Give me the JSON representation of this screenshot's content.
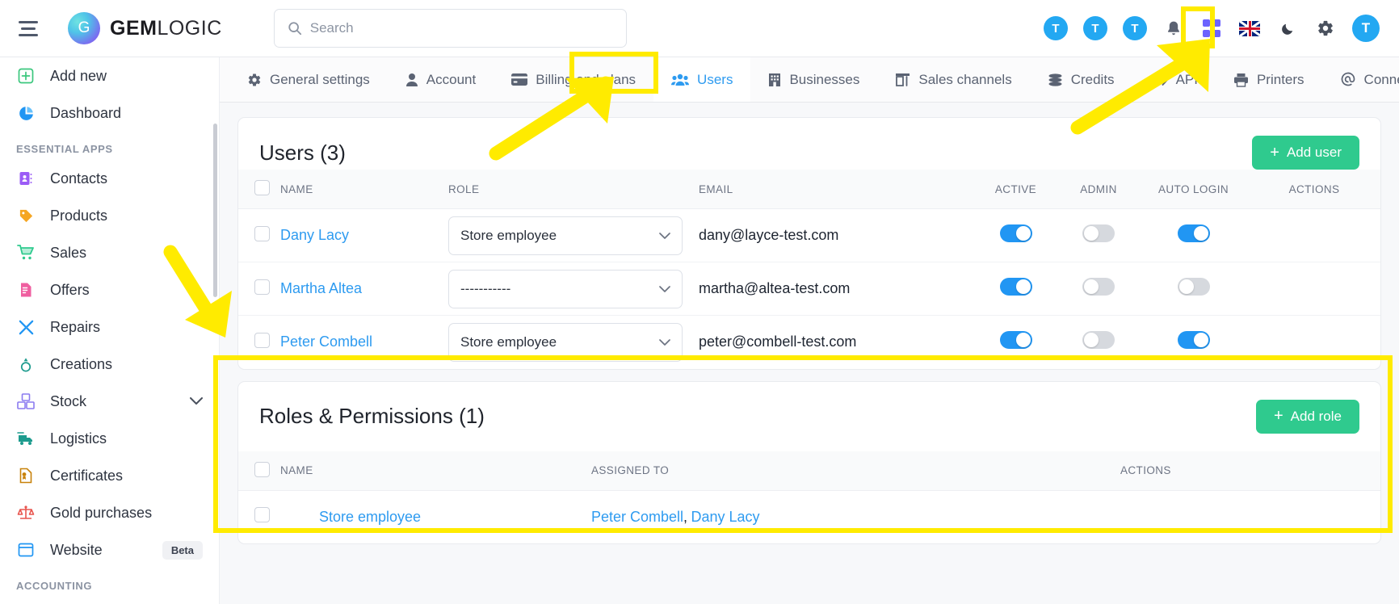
{
  "app": {
    "brand_bold": "GEM",
    "brand_light": "LOGIC",
    "brand_mark_letter": "G"
  },
  "search": {
    "placeholder": "Search",
    "value": ""
  },
  "topbar": {
    "avatars": [
      "T",
      "T",
      "T"
    ],
    "user_avatar": "T",
    "icons": [
      "bell-icon",
      "apps-grid-icon",
      "uk-flag-icon",
      "dark-mode-icon",
      "gear-icon"
    ]
  },
  "sidebar": {
    "items": [
      {
        "label": "Add new",
        "icon": "plus-square-icon",
        "color": "#3bc77d"
      },
      {
        "label": "Dashboard",
        "icon": "pie-chart-icon",
        "color": "#2196f3"
      }
    ],
    "group_label": "ESSENTIAL APPS",
    "apps": [
      {
        "label": "Contacts",
        "icon": "contacts-book-icon",
        "color": "#9b5cf6"
      },
      {
        "label": "Products",
        "icon": "price-tag-icon",
        "color": "#f5a623"
      },
      {
        "label": "Sales",
        "icon": "shopping-cart-icon",
        "color": "#2fca8e"
      },
      {
        "label": "Offers",
        "icon": "offer-document-icon",
        "color": "#ef5fa0"
      },
      {
        "label": "Repairs",
        "icon": "tools-icon",
        "color": "#2196f3"
      },
      {
        "label": "Creations",
        "icon": "ring-icon",
        "color": "#1d9b8e"
      },
      {
        "label": "Stock",
        "icon": "boxes-icon",
        "color": "#8b7bf0",
        "chevron": "⌄"
      },
      {
        "label": "Logistics",
        "icon": "delivery-truck-icon",
        "color": "#1d9b8e"
      },
      {
        "label": "Certificates",
        "icon": "certificate-icon",
        "color": "#c8820a"
      },
      {
        "label": "Gold purchases",
        "icon": "scales-icon",
        "color": "#e8554e"
      },
      {
        "label": "Website",
        "icon": "browser-window-icon",
        "color": "#2196f3",
        "badge": "Beta"
      }
    ],
    "group_label_2": "ACCOUNTING"
  },
  "tabs": [
    {
      "label": "General settings",
      "icon": "gear-icon",
      "active": false
    },
    {
      "label": "Account",
      "icon": "person-icon",
      "active": false
    },
    {
      "label": "Billing and plans",
      "icon": "credit-card-icon",
      "active": false
    },
    {
      "label": "Users",
      "icon": "users-group-icon",
      "active": true
    },
    {
      "label": "Businesses",
      "icon": "building-icon",
      "active": false
    },
    {
      "label": "Sales channels",
      "icon": "storefront-icon",
      "active": false
    },
    {
      "label": "Credits",
      "icon": "coins-icon",
      "active": false
    },
    {
      "label": "API",
      "icon": "code-brackets-icon",
      "active": false
    },
    {
      "label": "Printers",
      "icon": "printer-icon",
      "active": false
    },
    {
      "label": "Connections",
      "icon": "at-link-icon",
      "active": false
    }
  ],
  "users_panel": {
    "title": "Users (3)",
    "add_button": "Add user",
    "add_button_plus": "+",
    "columns": [
      "NAME",
      "ROLE",
      "EMAIL",
      "ACTIVE",
      "ADMIN",
      "AUTO LOGIN",
      "ACTIONS"
    ],
    "rows": [
      {
        "name": "Dany Lacy",
        "role": "Store employee",
        "email": "dany@layce-test.com",
        "active": true,
        "admin": false,
        "auto_login": true
      },
      {
        "name": "Martha Altea",
        "role": "-----------",
        "email": "martha@altea-test.com",
        "active": true,
        "admin": false,
        "auto_login": false
      },
      {
        "name": "Peter Combell",
        "role": "Store employee",
        "email": "peter@combell-test.com",
        "active": true,
        "admin": false,
        "auto_login": true
      }
    ]
  },
  "roles_panel": {
    "title": "Roles & Permissions (1)",
    "add_button": "Add role",
    "add_button_plus": "+",
    "columns": [
      "NAME",
      "ASSIGNED TO",
      "ACTIONS"
    ],
    "rows": [
      {
        "name": "Store employee",
        "assigned_to": [
          "Peter Combell",
          "Dany Lacy"
        ],
        "assigned_separator": ","
      }
    ]
  },
  "annotations": {
    "highlight_color": "#ffeb00",
    "boxes": [
      "users-tab",
      "gear-icon",
      "roles-permissions-panel"
    ],
    "arrows": [
      "arrow-to-users-tab",
      "arrow-to-gear-icon",
      "arrow-to-roles-panel"
    ]
  }
}
